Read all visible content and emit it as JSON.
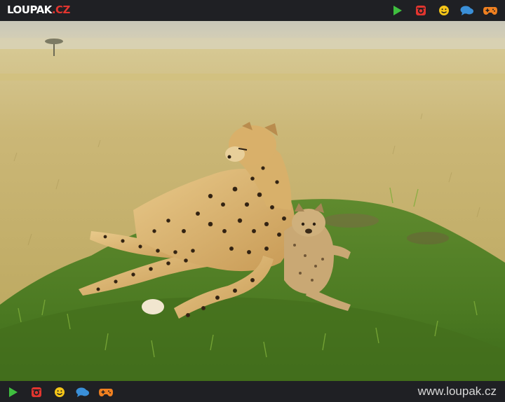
{
  "header": {
    "logo_main": "LOUPAK",
    "logo_suffix": ".CZ",
    "icons": [
      "play-icon",
      "instagram-icon",
      "smiley-icon",
      "chat-icon",
      "gamepad-icon"
    ]
  },
  "footer": {
    "url": "www.loupak.cz",
    "icons": [
      "play-icon",
      "instagram-icon",
      "smiley-icon",
      "chat-icon",
      "gamepad-icon"
    ]
  },
  "colors": {
    "bar_bg": "#1f2024",
    "play": "#3fbf3f",
    "instagram": "#e2352f",
    "smiley": "#f5c518",
    "chat": "#3a8fd8",
    "gamepad": "#f08020"
  },
  "image": {
    "subject": "cheetah-mother-and-cub-photo"
  }
}
